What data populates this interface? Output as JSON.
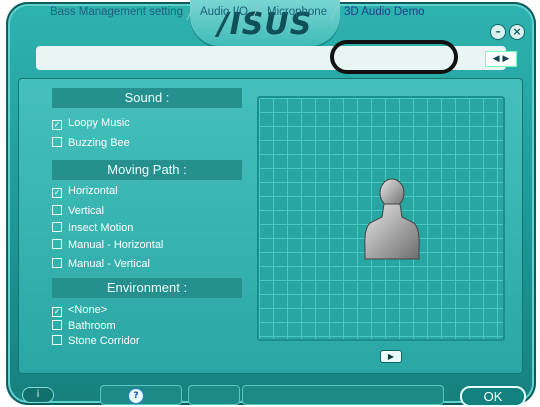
{
  "brand": {
    "logo_text": "/ISUS"
  },
  "window_buttons": {
    "minimize_icon": "minimize-icon",
    "close_icon": "close-icon"
  },
  "tabs": [
    {
      "label": "Bass Management setting"
    },
    {
      "label": "Audio I/O"
    },
    {
      "label": "Microphone"
    },
    {
      "label": "3D Audio Demo",
      "active": true
    }
  ],
  "sound": {
    "heading": "Sound :",
    "options": [
      {
        "label": "Loopy Music",
        "checked": true
      },
      {
        "label": "Buzzing Bee",
        "checked": false
      }
    ]
  },
  "moving_path": {
    "heading": "Moving Path :",
    "options": [
      {
        "label": "Horizontal",
        "checked": true
      },
      {
        "label": "Vertical",
        "checked": false
      },
      {
        "label": "Insect Motion",
        "checked": false
      },
      {
        "label": "Manual - Horizontal",
        "checked": false
      },
      {
        "label": "Manual - Vertical",
        "checked": false
      }
    ]
  },
  "environment": {
    "heading": "Environment :",
    "options": [
      {
        "label": "<None>",
        "checked": true
      },
      {
        "label": "Bathroom",
        "checked": false
      },
      {
        "label": "Stone Corridor",
        "checked": false
      }
    ]
  },
  "footer": {
    "info_label": "i",
    "ok_label": "OK"
  },
  "colors": {
    "accent": "#2aa7a4",
    "dark": "#138180",
    "highlight_ring": "#111111"
  }
}
